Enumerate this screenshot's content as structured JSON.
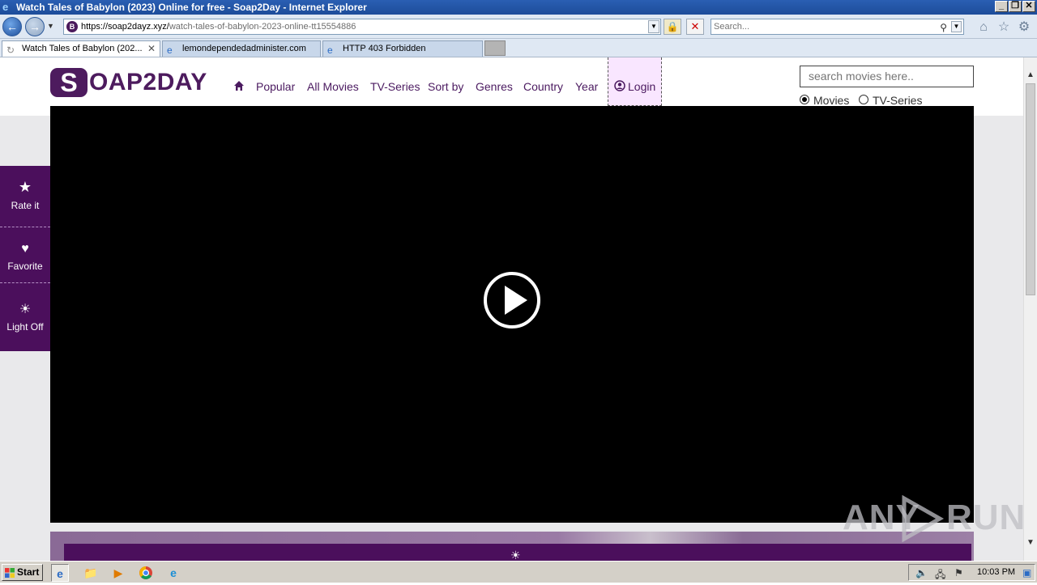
{
  "window": {
    "title": "Watch Tales of Babylon (2023) Online for free - Soap2Day - Internet Explorer",
    "btn_minimize": "_",
    "btn_restore": "❐",
    "btn_close": "✕"
  },
  "addressbar": {
    "url_domain": "https://soap2dayz.xyz/",
    "url_path": "watch-tales-of-babylon-2023-online-tt15554886",
    "search_placeholder": "Search..."
  },
  "tabs": [
    {
      "label": "Watch Tales of Babylon (202...",
      "active": true
    },
    {
      "label": "lemondependedadminister.com",
      "active": false
    },
    {
      "label": "HTTP 403 Forbidden",
      "active": false
    }
  ],
  "site": {
    "logo_first": "S",
    "logo_rest": "OAP2DAY",
    "nav": [
      "Popular",
      "All Movies",
      "TV-Series",
      "Sort by",
      "Genres",
      "Country",
      "Year"
    ],
    "login_label": "Login",
    "search_placeholder": "search movies here..",
    "radio_movies": "Movies",
    "radio_tvseries": "TV-Series",
    "selected_type": "Movies"
  },
  "sidetools": [
    {
      "label": "Rate it",
      "icon": "star-icon"
    },
    {
      "label": "Favorite",
      "icon": "heart-icon"
    },
    {
      "label": "Light Off",
      "icon": "sun-icon"
    }
  ],
  "taskbar": {
    "start_label": "Start",
    "clock": "10:03 PM"
  },
  "watermark": {
    "left": "ANY",
    "right": "RUN"
  },
  "colors": {
    "brand_purple": "#4b0f5c",
    "login_bg": "#f9e6ff",
    "player_bg": "#000000"
  }
}
